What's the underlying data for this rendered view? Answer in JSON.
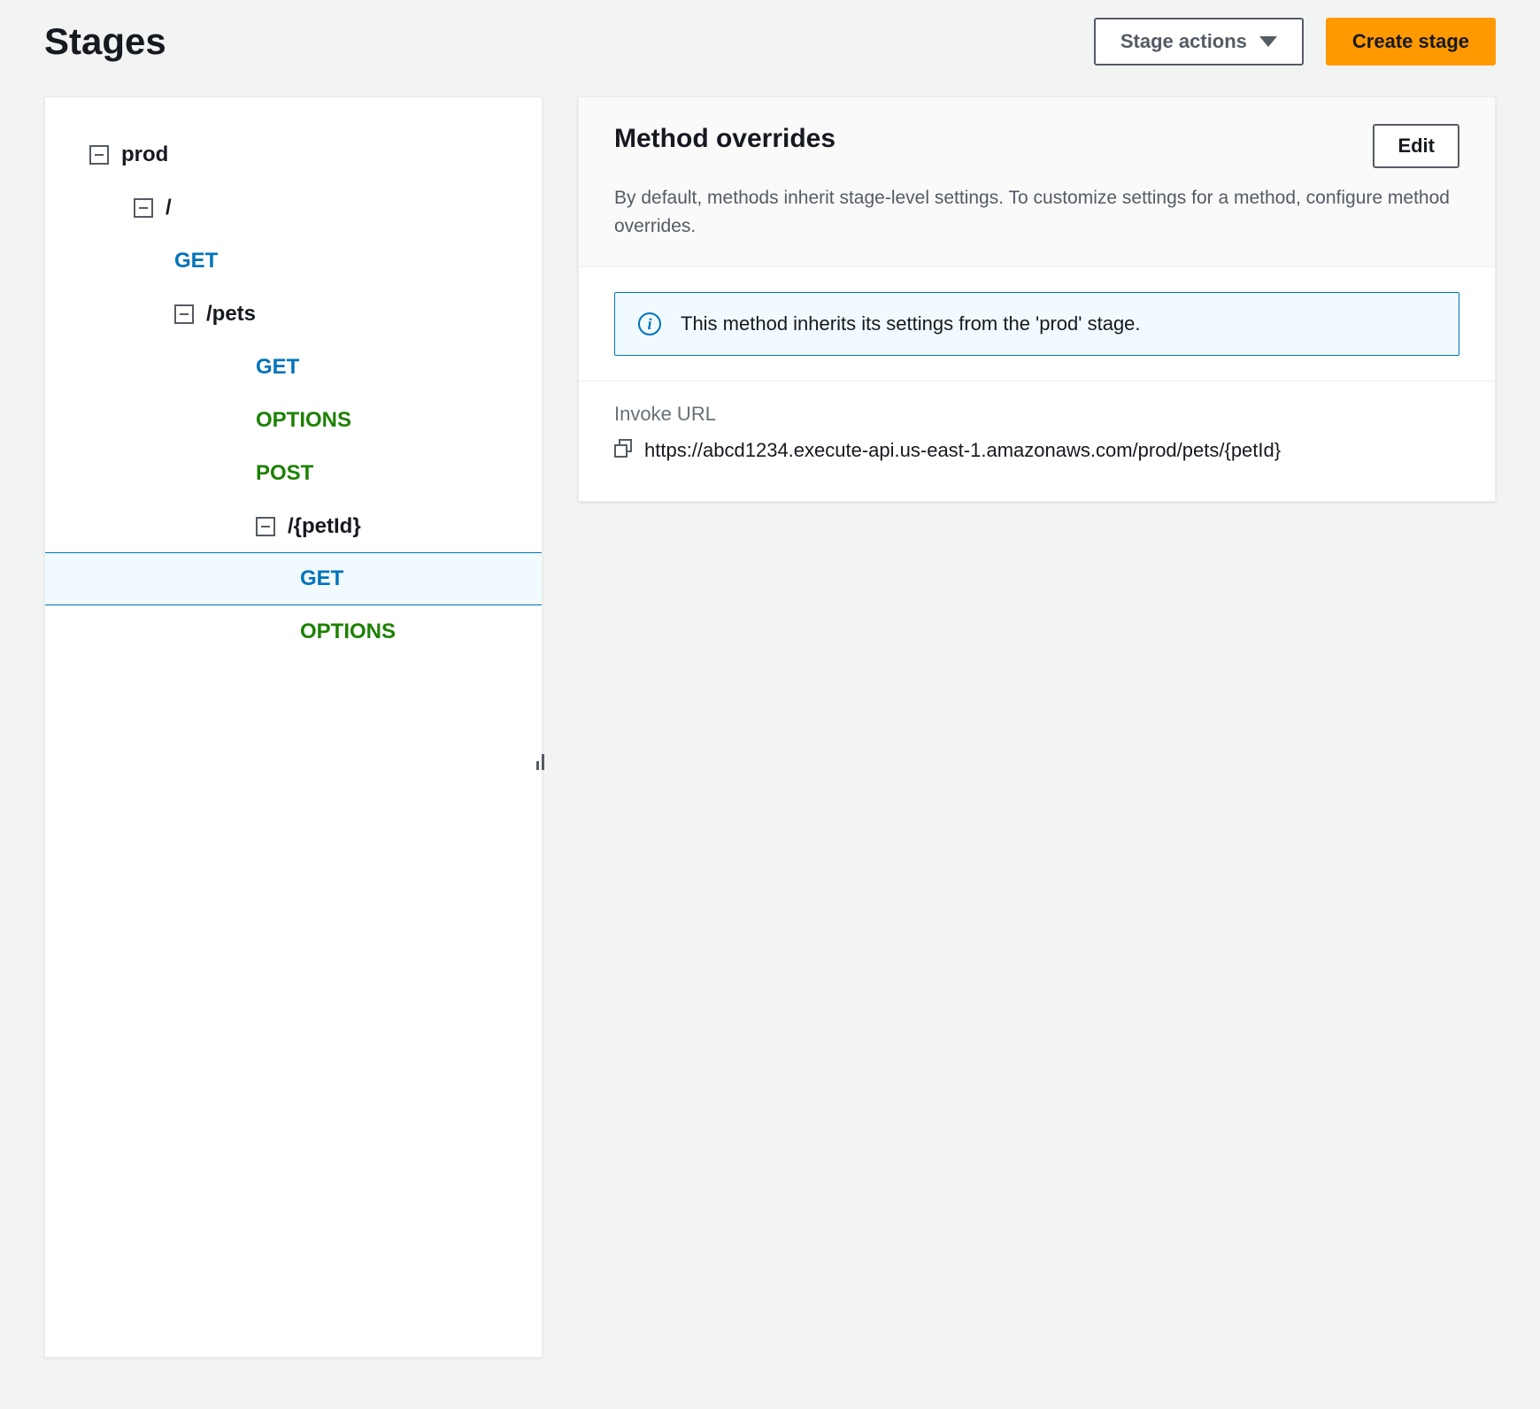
{
  "page_title": "Stages",
  "buttons": {
    "stage_actions": "Stage actions",
    "create_stage": "Create stage",
    "edit": "Edit"
  },
  "tree": {
    "stage": "prod",
    "root": "/",
    "root_get": "GET",
    "pets": "/pets",
    "pets_get": "GET",
    "pets_options": "OPTIONS",
    "pets_post": "POST",
    "petid": "/{petId}",
    "petid_get": "GET",
    "petid_options": "OPTIONS"
  },
  "detail": {
    "title": "Method overrides",
    "description": "By default, methods inherit stage-level settings. To customize settings for a method, configure method overrides.",
    "info_message": "This method inherits its settings from the 'prod' stage.",
    "invoke_label": "Invoke URL",
    "invoke_url": "https://abcd1234.execute-api.us-east-1.amazonaws.com/prod/pets/{petId}"
  }
}
